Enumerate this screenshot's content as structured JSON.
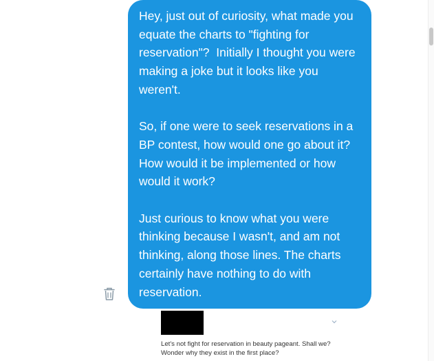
{
  "message": {
    "paragraphs": [
      "Hey, just out of curiosity, what made you equate the charts to \"fighting for reservation\"?  Initially I thought you were making a joke but it looks like you weren't.",
      "So, if one were to seek reservations in a BP contest, how would one go about it? How would it be implemented or how would it work?",
      "Just curious to know what you were thinking because I wasn't, and am not thinking, along those lines. The charts certainly have nothing to do with reservation."
    ],
    "bubble_color": "#1b95e0",
    "text_color": "#ffffff"
  },
  "delete_action": {
    "icon": "trash-icon"
  },
  "quoted_tweet": {
    "text": "Let's not fight for reservation in beauty pageant. Shall we? Wonder why they exist in the first place?",
    "menu_icon": "chevron-down-icon"
  }
}
